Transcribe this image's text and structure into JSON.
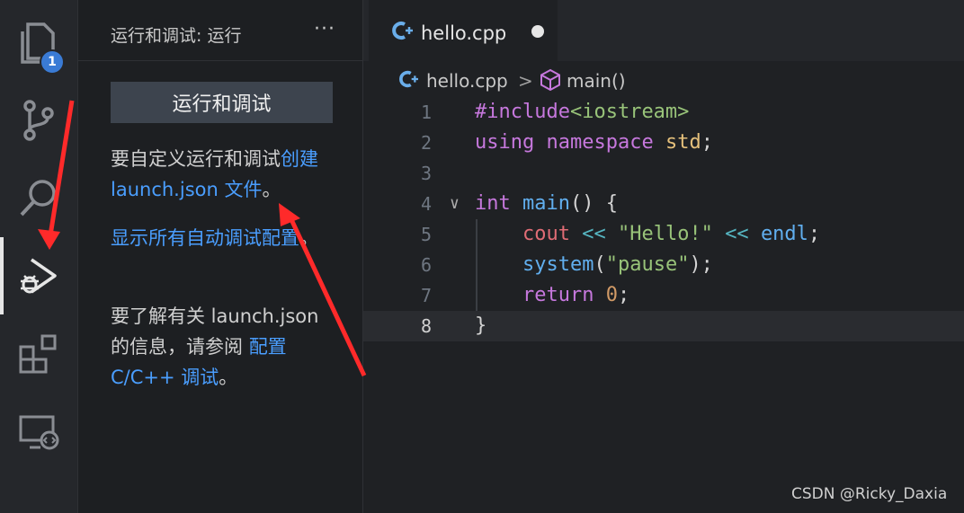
{
  "activity_bar": {
    "explorer_badge": "1"
  },
  "sidebar": {
    "title": "运行和调试: 运行",
    "more": "···",
    "run_button": "运行和调试",
    "para1_text": "要自定义运行和调试",
    "para1_link": "创建 launch.json 文件",
    "para1_end": "。",
    "para2_link": "显示所有自动调试配置",
    "para2_end": "。",
    "para3_text": "要了解有关 launch.json 的信息，请参阅 ",
    "para3_link": "配置 C/C++ 调试",
    "para3_end": "。"
  },
  "editor": {
    "tab_label": "hello.cpp",
    "breadcrumb_file": "hello.cpp",
    "breadcrumb_sep": ">",
    "breadcrumb_symbol": "main()",
    "line_numbers": [
      "1",
      "2",
      "3",
      "4",
      "5",
      "6",
      "7",
      "8"
    ],
    "fold_marker": "∨",
    "code": {
      "l1_a": "#include",
      "l1_b": "<iostream>",
      "l2_a": "using",
      "l2_b": "namespace",
      "l2_c": "std",
      "l2_d": ";",
      "l4_a": "int",
      "l4_b": "main",
      "l4_c": "() {",
      "l5_a": "cout",
      "l5_b": "<<",
      "l5_c": "\"Hello!\"",
      "l5_d": "<<",
      "l5_e": "endl",
      "l5_f": ";",
      "l6_a": "system",
      "l6_b": "(",
      "l6_c": "\"pause\"",
      "l6_d": ");",
      "l7_a": "return",
      "l7_b": "0",
      "l7_c": ";",
      "l8_a": "}"
    }
  },
  "watermark": "CSDN @Ricky_Daxia",
  "colors": {
    "link": "#4a9eff",
    "annotation_arrow": "#ff2a2a"
  }
}
